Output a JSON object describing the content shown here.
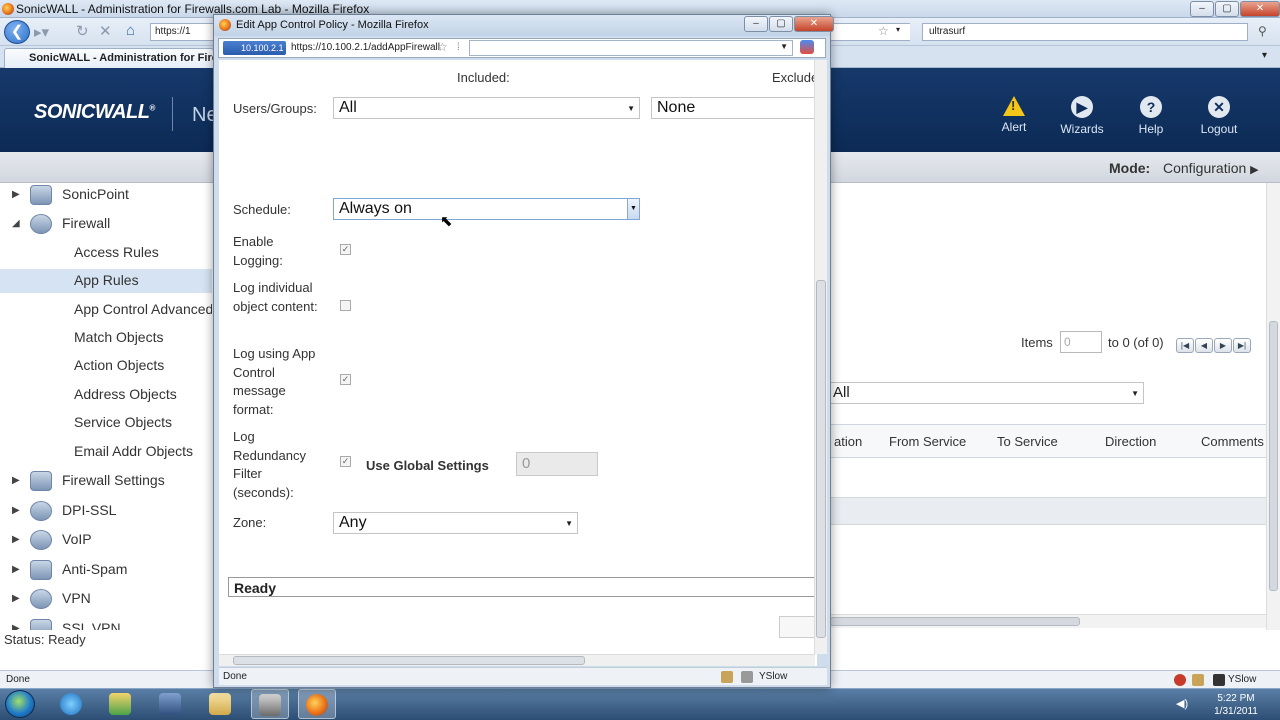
{
  "bg_window": {
    "title": "SonicWALL - Administration for Firewalls.com Lab - Mozilla Firefox",
    "url_fragment": "https://1",
    "search_text": "ultrasurf",
    "tab_label": "SonicWALL - Administration for Fire...",
    "status": "Done"
  },
  "sonicwall": {
    "logo": "SONICWALL",
    "header_partial": "Ne",
    "header_items": [
      {
        "label": "Alert",
        "icon": "alert-icon"
      },
      {
        "label": "Wizards",
        "icon": "wizards-icon"
      },
      {
        "label": "Help",
        "icon": "help-icon"
      },
      {
        "label": "Logout",
        "icon": "logout-icon"
      }
    ],
    "mode_label": "Mode:",
    "mode_value": "Configuration",
    "status_line": "Status: Ready"
  },
  "nav": {
    "items": [
      {
        "label": "SonicPoint",
        "level": 0,
        "arrow": "▶"
      },
      {
        "label": "Firewall",
        "level": 0,
        "arrow": "◢"
      },
      {
        "label": "Access Rules",
        "level": 1
      },
      {
        "label": "App Rules",
        "level": 1,
        "selected": true
      },
      {
        "label": "App Control Advanced",
        "level": 1
      },
      {
        "label": "Match Objects",
        "level": 1
      },
      {
        "label": "Action Objects",
        "level": 1
      },
      {
        "label": "Address Objects",
        "level": 1
      },
      {
        "label": "Service Objects",
        "level": 1
      },
      {
        "label": "Email Addr Objects",
        "level": 1
      },
      {
        "label": "Firewall Settings",
        "level": 0,
        "arrow": "▶"
      },
      {
        "label": "DPI-SSL",
        "level": 0,
        "arrow": "▶"
      },
      {
        "label": "VoIP",
        "level": 0,
        "arrow": "▶"
      },
      {
        "label": "Anti-Spam",
        "level": 0,
        "arrow": "▶"
      },
      {
        "label": "VPN",
        "level": 0,
        "arrow": "▶"
      },
      {
        "label": "SSL VPN",
        "level": 0,
        "arrow": "▶"
      }
    ]
  },
  "content": {
    "items_label": "Items",
    "items_value": "0",
    "items_range": "to 0 (of 0)",
    "filter_value": "All",
    "columns": [
      "ation",
      "From Service",
      "To Service",
      "Direction",
      "Comments"
    ]
  },
  "popup": {
    "title": "Edit App Control Policy - Mozilla Firefox",
    "ip_badge": "10.100.2.1",
    "url": "https://10.100.2.1/addAppFirewall",
    "included_header": "Included:",
    "excluded_header": "Exclude",
    "users_label": "Users/Groups:",
    "users_included": "All",
    "users_excluded": "None",
    "schedule_label": "Schedule:",
    "schedule_value": "Always on",
    "enable_logging_label": "Enable Logging:",
    "log_individual_label": "Log individual object content:",
    "log_app_control_label": "Log using App Control message format:",
    "log_redundancy_label": "Log Redundancy Filter (seconds):",
    "use_global_label": "Use Global Settings",
    "redundancy_value": "0",
    "zone_label": "Zone:",
    "zone_value": "Any",
    "ready_text": "Ready",
    "status": "Done",
    "yslow": "YSlow",
    "checkboxes": {
      "enable_logging": true,
      "log_individual": false,
      "log_app_control": true,
      "use_global": true
    }
  },
  "taskbar": {
    "time": "5:22 PM",
    "date": "1/31/2011",
    "tray_yslow": "YSlow"
  }
}
